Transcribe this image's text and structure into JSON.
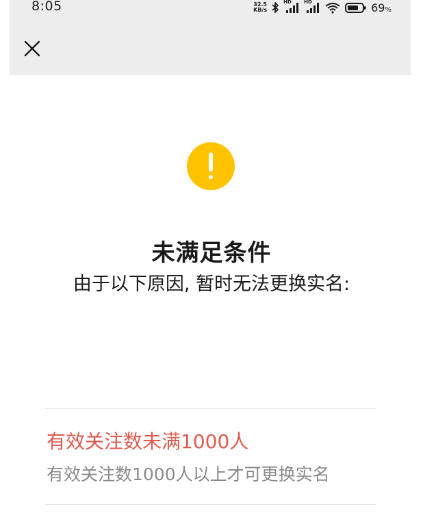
{
  "status_bar": {
    "time": "8:05",
    "net_speed_value": "32.5",
    "net_speed_unit": "KB/s",
    "signal1_label": "HD",
    "signal2_label": "HD",
    "battery_percent": "69",
    "battery_unit": "%"
  },
  "nav": {
    "close_icon": "close-icon"
  },
  "warning": {
    "icon": "exclamation-icon",
    "color": "#ffc300"
  },
  "content": {
    "title": "未满足条件",
    "subtitle": "由于以下原因, 暂时无法更换实名:"
  },
  "reasons": [
    {
      "title": "有效关注数未满1000人",
      "description": "有效关注数1000人以上才可更换实名",
      "title_color": "#e05a4e"
    }
  ]
}
